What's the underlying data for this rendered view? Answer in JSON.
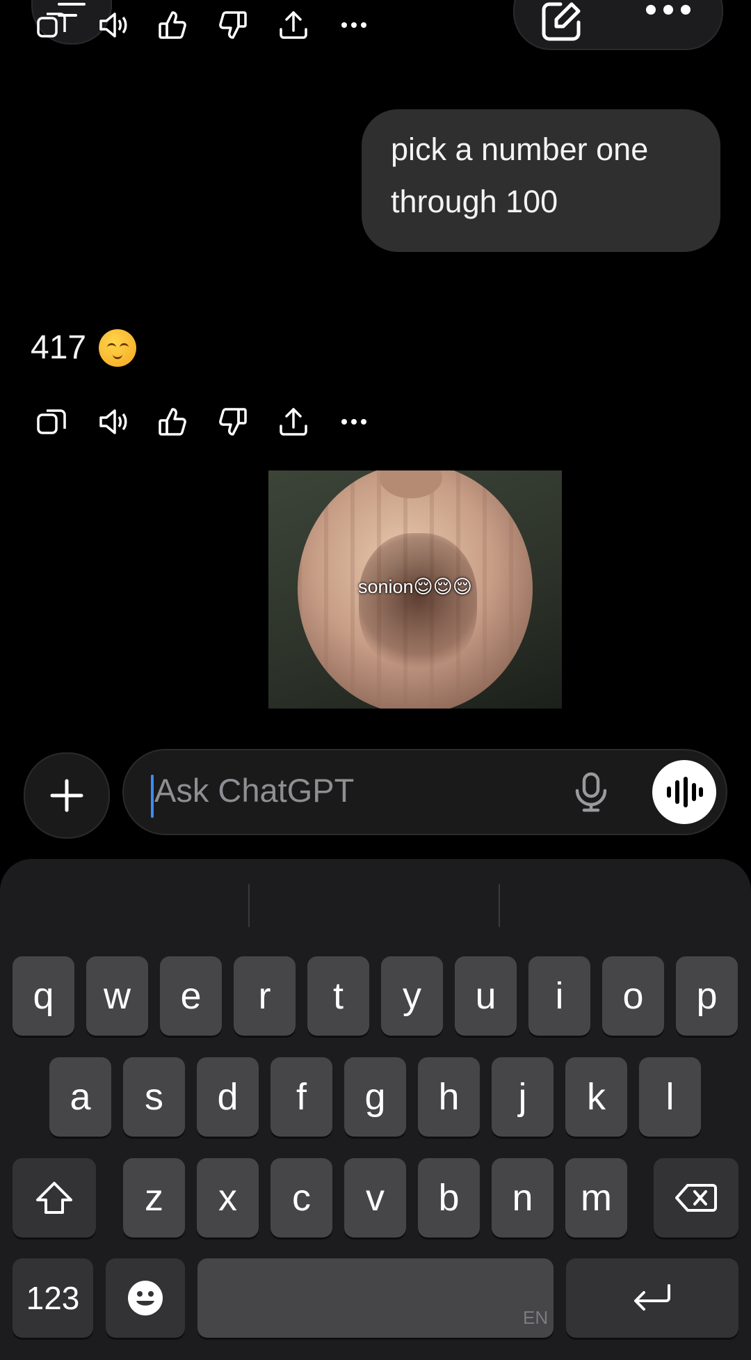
{
  "conversation": {
    "user_message": "pick a number one through 100",
    "assistant_reply": "417",
    "reply_emoji": "relieved-face",
    "meme_caption": "sonion😌😌😌"
  },
  "composer": {
    "placeholder": "Ask ChatGPT"
  },
  "keyboard": {
    "row1": [
      "q",
      "w",
      "e",
      "r",
      "t",
      "y",
      "u",
      "i",
      "o",
      "p"
    ],
    "row2": [
      "a",
      "s",
      "d",
      "f",
      "g",
      "h",
      "j",
      "k",
      "l"
    ],
    "row3": [
      "z",
      "x",
      "c",
      "v",
      "b",
      "n",
      "m"
    ],
    "numbers_key": "123",
    "language": "EN"
  },
  "colors": {
    "background": "#000000",
    "user_bubble": "#2f2f2f",
    "key": "#464649",
    "keyboard_bg": "#1c1c1e",
    "caret": "#3d8bfd"
  }
}
